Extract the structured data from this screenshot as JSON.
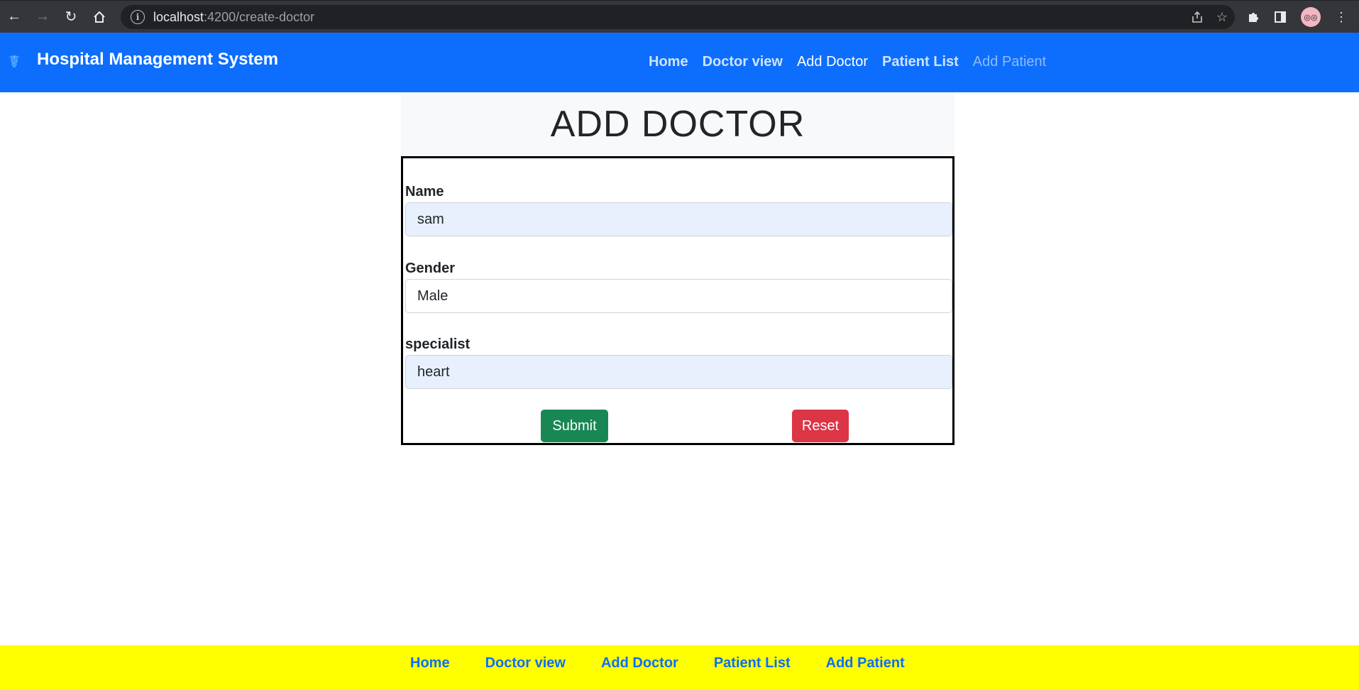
{
  "browser": {
    "url_host": "localhost",
    "url_path": ":4200/create-doctor",
    "icons": {
      "back": "arrow-left-icon",
      "forward": "arrow-right-icon",
      "reload": "reload-icon",
      "home": "home-icon",
      "info": "info-icon",
      "share": "share-icon",
      "bookmark": "star-icon",
      "extensions": "puzzle-icon",
      "sidepanel": "side-panel-icon",
      "menu": "kebab-menu-icon"
    }
  },
  "navbar": {
    "brand": "Hospital Management System",
    "links": [
      {
        "label": "Home"
      },
      {
        "label": "Doctor view"
      },
      {
        "label": "Add Doctor"
      },
      {
        "label": "Patient List"
      },
      {
        "label": "Add Patient"
      }
    ],
    "colors": {
      "background": "#0d6efd"
    }
  },
  "page": {
    "heading": "ADD DOCTOR"
  },
  "form": {
    "name": {
      "label": "Name",
      "value": "sam"
    },
    "gender": {
      "label": "Gender",
      "value": "Male"
    },
    "specialist": {
      "label": "specialist",
      "value": "heart"
    },
    "submit_label": "Submit",
    "reset_label": "Reset",
    "colors": {
      "submit": "#198754",
      "reset": "#dc3545",
      "autofill": "#e8f0fe"
    }
  },
  "footer": {
    "links": [
      {
        "label": "Home"
      },
      {
        "label": "Doctor view"
      },
      {
        "label": "Add Doctor"
      },
      {
        "label": "Patient List"
      },
      {
        "label": "Add Patient"
      }
    ],
    "colors": {
      "background": "#ffff00",
      "link": "#0d6efd"
    }
  }
}
